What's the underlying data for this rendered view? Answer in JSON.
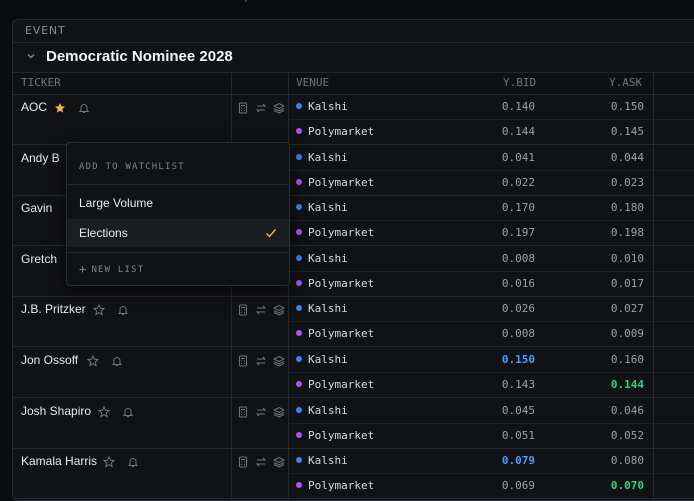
{
  "event_label": "EVENT",
  "event_title": "Democratic Nominee 2028",
  "columns": {
    "ticker": "TICKER",
    "venue": "VENUE",
    "ybid": "Y.BID",
    "yask": "Y.ASK"
  },
  "colors": {
    "kalshi": "#3b82f6",
    "polymarket": "#a855f7",
    "star_active": "#f5b82e",
    "bid_highlight": "#4b9dff",
    "ask_highlight": "#2fd47a"
  },
  "rows": [
    {
      "name": "AOC",
      "starred": true,
      "quotes": [
        {
          "venue": "Kalshi",
          "bid": "0.140",
          "ask": "0.150"
        },
        {
          "venue": "Polymarket",
          "bid": "0.144",
          "ask": "0.145"
        }
      ]
    },
    {
      "name": "Andy B",
      "quotes": [
        {
          "venue": "Kalshi",
          "bid": "0.041",
          "ask": "0.044"
        },
        {
          "venue": "Polymarket",
          "bid": "0.022",
          "ask": "0.023"
        }
      ]
    },
    {
      "name": "Gavin",
      "quotes": [
        {
          "venue": "Kalshi",
          "bid": "0.170",
          "ask": "0.180"
        },
        {
          "venue": "Polymarket",
          "bid": "0.197",
          "ask": "0.198"
        }
      ]
    },
    {
      "name": "Gretch",
      "quotes": [
        {
          "venue": "Kalshi",
          "bid": "0.008",
          "ask": "0.010"
        },
        {
          "venue": "Polymarket",
          "bid": "0.016",
          "ask": "0.017"
        }
      ]
    },
    {
      "name": "J.B. Pritzker",
      "quotes": [
        {
          "venue": "Kalshi",
          "bid": "0.026",
          "ask": "0.027"
        },
        {
          "venue": "Polymarket",
          "bid": "0.008",
          "ask": "0.009"
        }
      ]
    },
    {
      "name": "Jon Ossoff",
      "quotes": [
        {
          "venue": "Kalshi",
          "bid": "0.150",
          "ask": "0.160",
          "bid_hl": true
        },
        {
          "venue": "Polymarket",
          "bid": "0.143",
          "ask": "0.144",
          "ask_hl": true
        }
      ]
    },
    {
      "name": "Josh Shapiro",
      "quotes": [
        {
          "venue": "Kalshi",
          "bid": "0.045",
          "ask": "0.046"
        },
        {
          "venue": "Polymarket",
          "bid": "0.051",
          "ask": "0.052"
        }
      ]
    },
    {
      "name": "Kamala Harris",
      "quotes": [
        {
          "venue": "Kalshi",
          "bid": "0.079",
          "ask": "0.080",
          "bid_hl": true
        },
        {
          "venue": "Polymarket",
          "bid": "0.069",
          "ask": "0.070",
          "ask_hl": true
        }
      ]
    }
  ],
  "watchlist_dropdown": {
    "heading": "ADD TO WATCHLIST",
    "items": [
      {
        "label": "Large Volume",
        "checked": false
      },
      {
        "label": "Elections",
        "checked": true
      }
    ],
    "new_list": "NEW LIST"
  }
}
